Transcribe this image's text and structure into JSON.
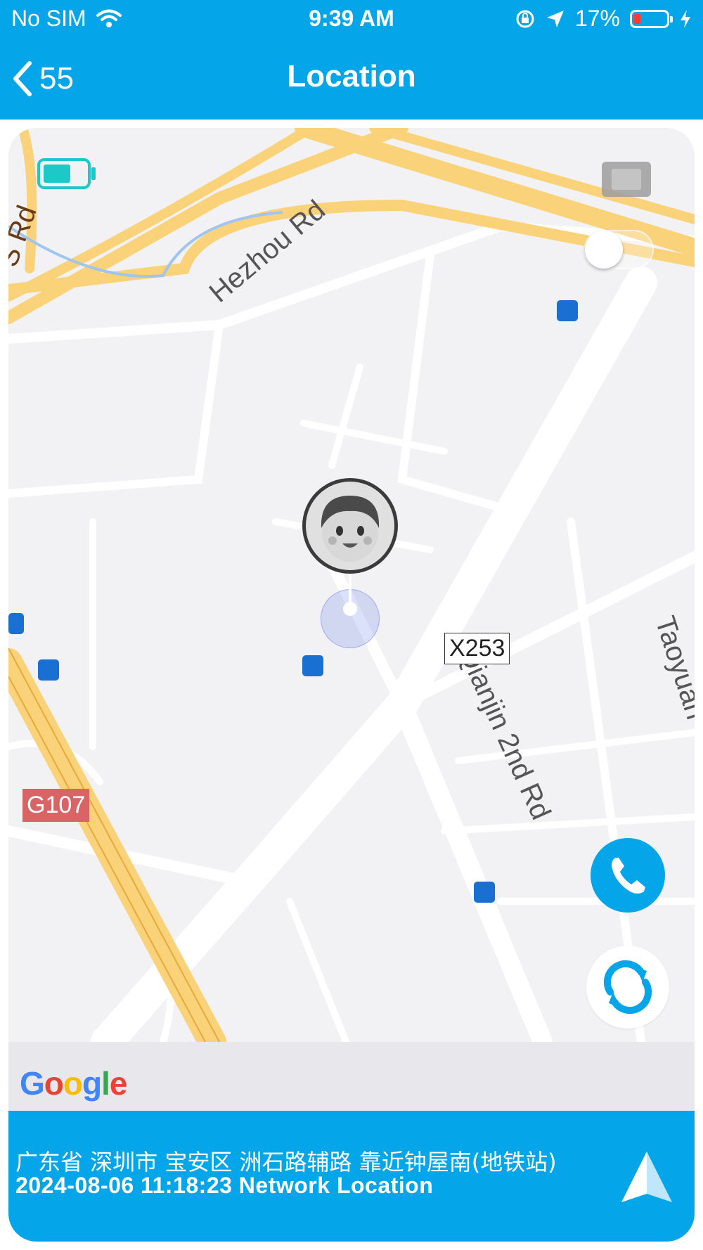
{
  "status": {
    "carrier": "No SIM",
    "time": "9:39 AM",
    "battery_percent": "17%"
  },
  "nav": {
    "back_label": "55",
    "title": "Location"
  },
  "map": {
    "road_labels": [
      "Hezhou Rd",
      "Qianjin 2nd Rd",
      "Taoyuan",
      "S Rd"
    ],
    "shields": {
      "x253": "X253",
      "g107": "G107"
    },
    "device_battery_icon": "battery-icon",
    "layers_icon": "layers-icon",
    "call_icon": "phone-icon",
    "refresh_icon": "refresh-icon",
    "attribution": "Google"
  },
  "info": {
    "address": "广东省 深圳市 宝安区 洲石路辅路 靠近钟屋南(地铁站)",
    "timestamp": "2024-08-06 11:18:23 Network Location",
    "navigate_icon": "navigation-arrow-icon"
  },
  "colors": {
    "accent": "#05a6e9",
    "highway": "#f9d27a",
    "map_bg": "#f2f2f4"
  }
}
